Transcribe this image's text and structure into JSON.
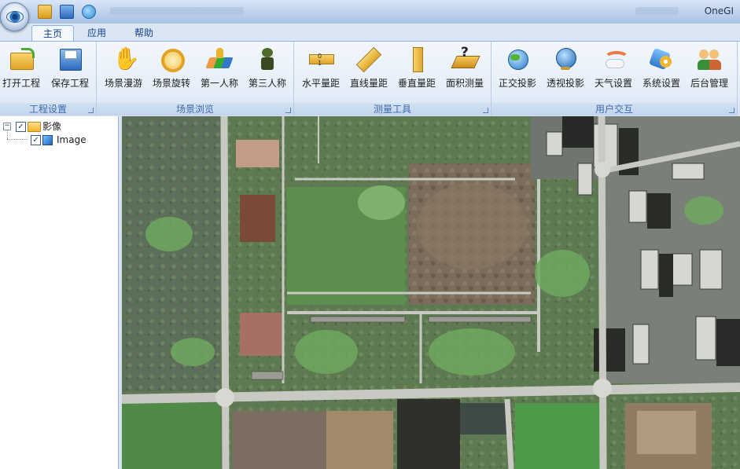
{
  "window": {
    "title": "OneGI"
  },
  "tabs": [
    {
      "label": "主页"
    },
    {
      "label": "应用"
    },
    {
      "label": "帮助"
    }
  ],
  "ribbon": {
    "groups": [
      {
        "label": "工程设置",
        "buttons": [
          {
            "label": "打开工程"
          },
          {
            "label": "保存工程"
          }
        ]
      },
      {
        "label": "场景浏览",
        "buttons": [
          {
            "label": "场景漫游"
          },
          {
            "label": "场景旋转"
          },
          {
            "label": "第一人称"
          },
          {
            "label": "第三人称"
          }
        ]
      },
      {
        "label": "测量工具",
        "buttons": [
          {
            "label": "水平量距"
          },
          {
            "label": "直线量距"
          },
          {
            "label": "垂直量距"
          },
          {
            "label": "面积测量"
          }
        ]
      },
      {
        "label": "用户交互",
        "buttons": [
          {
            "label": "正交投影"
          },
          {
            "label": "透视投影"
          },
          {
            "label": "天气设置"
          },
          {
            "label": "系统设置"
          },
          {
            "label": "后台管理"
          }
        ]
      }
    ]
  },
  "tree": {
    "root": {
      "label": "影像",
      "checked": true,
      "expanded": true
    },
    "children": [
      {
        "label": "Image",
        "checked": true
      }
    ]
  },
  "colors": {
    "accent": "#15428b",
    "ribbon_border": "#8db2e3",
    "group_label": "#3e6aaa"
  }
}
